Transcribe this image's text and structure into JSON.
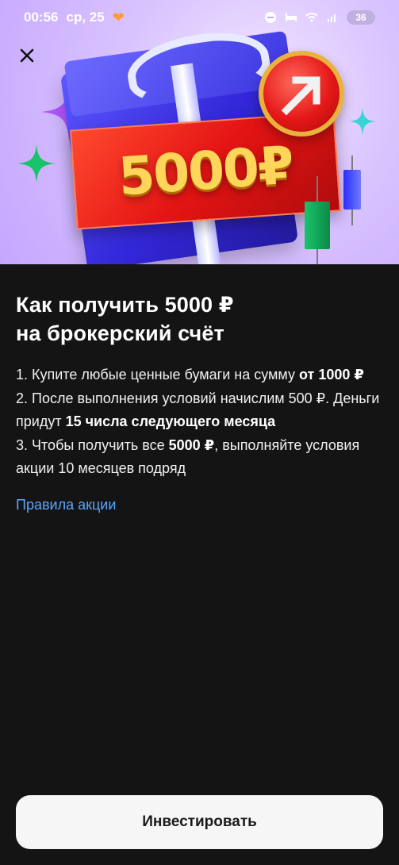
{
  "status_bar": {
    "time": "00:56",
    "date": "ср, 25",
    "battery": "36"
  },
  "hero": {
    "banner_amount": "5000₽"
  },
  "title_line1": "Как получить 5000 ₽",
  "title_line2": "на брокерский счёт",
  "steps": {
    "s1_a": "1. Купите любые ценные бумаги на сумму ",
    "s1_bold": "от 1000 ₽",
    "s2_a": "2. После выполнения условий начислим 500 ₽. Деньги придут ",
    "s2_bold": "15 числа следующего месяца",
    "s3_a": "3. Чтобы получить все ",
    "s3_bold": "5000 ₽",
    "s3_b": ", выполняйте условия акции 10 месяцев подряд"
  },
  "rules_link": "Правила акции",
  "cta_label": "Инвестировать",
  "colors": {
    "accent_link": "#5aa6ff",
    "background": "#141414",
    "cta_bg": "#f6f6f6"
  }
}
